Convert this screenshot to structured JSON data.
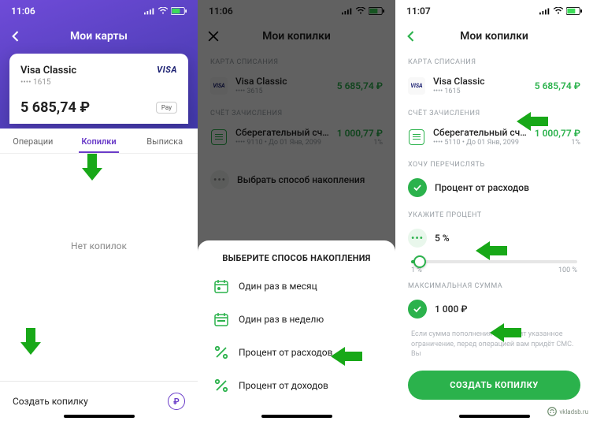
{
  "screen1": {
    "time": "11:06",
    "title": "Мои карты",
    "card": {
      "name": "Visa Classic",
      "mask": "•••• 1615",
      "balance": "5 685,74 ₽",
      "brand": "VISA",
      "pay": " Pay"
    },
    "tabs": {
      "t1": "Операции",
      "t2": "Копилки",
      "t3": "Выписка"
    },
    "empty": "Нет копилок",
    "create": "Создать копилку"
  },
  "screen2": {
    "time": "11:06",
    "title": "Мои копилки",
    "labels": {
      "debit": "КАРТА СПИСАНИЯ",
      "credit": "СЧЁТ ЗАЧИСЛЕНИЯ"
    },
    "debit": {
      "name": "Visa Classic",
      "mask": "•••• 3615",
      "amount": "5 685,74 ₽"
    },
    "credit": {
      "name": "Сберегательный счёт",
      "sub": "•••• 9110 • До 01 Янв, 2099",
      "amount": "1 000,77 ₽",
      "pct": "1%"
    },
    "choose": "Выбрать способ накопления",
    "sheet": {
      "title": "ВЫБЕРИТЕ СПОСОБ НАКОПЛЕНИЯ",
      "o1": "Один раз в месяц",
      "o2": "Один раз в неделю",
      "o3": "Процент от расходов",
      "o4": "Процент от доходов"
    }
  },
  "screen3": {
    "time": "11:07",
    "title": "Мои копилки",
    "labels": {
      "debit": "КАРТА СПИСАНИЯ",
      "credit": "СЧЁТ ЗАЧИСЛЕНИЯ",
      "want": "ХОЧУ ПЕРЕЧИСЛЯТЬ",
      "pct": "УКАЖИТЕ ПРОЦЕНТ",
      "max": "МАКСИМАЛЬНАЯ СУММА"
    },
    "debit": {
      "name": "Visa Classic",
      "mask": "•••• 1615",
      "amount": "5 685,74 ₽"
    },
    "credit": {
      "name": "Сберегательный счёт",
      "sub": "•••• 5110 • До 01 Янв, 2099",
      "amount": "1 000,77 ₽",
      "pct": "1%"
    },
    "method": "Процент от расходов",
    "percent": "5 %",
    "slider": {
      "min": "1 %",
      "max": "100 %"
    },
    "maxsum": "1 000 ₽",
    "hint": "Если сумма пополнения превысит указанное ограничение, перед операцией вам придёт СМС. Вы",
    "cta": "СОЗДАТЬ КОПИЛКУ"
  },
  "watermark": "vkladsb.ru"
}
